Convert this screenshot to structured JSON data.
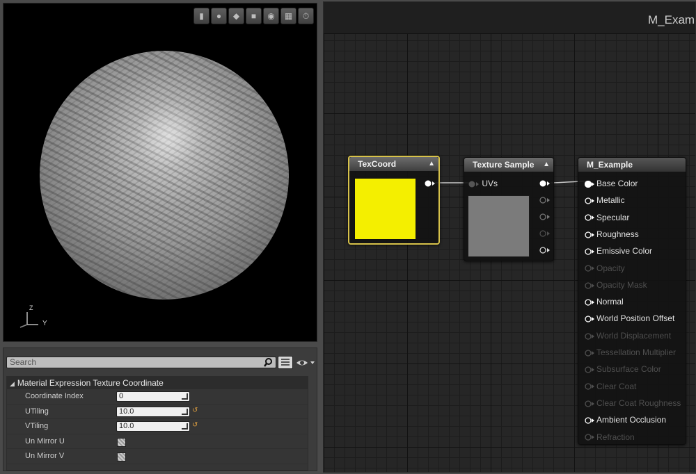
{
  "viewport": {
    "toolbar": [
      {
        "name": "cylinder-preview-icon",
        "glyph": "▮"
      },
      {
        "name": "sphere-preview-icon",
        "glyph": "●"
      },
      {
        "name": "plane-preview-icon",
        "glyph": "◆"
      },
      {
        "name": "cube-preview-icon",
        "glyph": "■"
      },
      {
        "name": "custom-mesh-icon",
        "glyph": "◉"
      },
      {
        "name": "grid-toggle-icon",
        "glyph": "▦"
      },
      {
        "name": "realtime-toggle-icon",
        "glyph": "⏱"
      }
    ],
    "axis_y": "Y",
    "axis_z": "Z"
  },
  "details": {
    "search_placeholder": "Search",
    "category_title": "Material Expression Texture Coordinate",
    "properties": [
      {
        "label": "Coordinate Index",
        "value": "0"
      },
      {
        "label": "UTiling",
        "value": "10.0"
      },
      {
        "label": "VTiling",
        "value": "10.0"
      },
      {
        "label": "Un Mirror U"
      },
      {
        "label": "Un Mirror V"
      }
    ],
    "reset_glyph": "↺"
  },
  "graph": {
    "title": "M_Example",
    "texcoord_node": {
      "title": "TexCoord",
      "swatch_color": "#f4ef00"
    },
    "texture_sample_node": {
      "title": "Texture Sample",
      "input_label": "UVs"
    },
    "result_node": {
      "title": "M_Example",
      "inputs": [
        {
          "label": "Base Color",
          "enabled": true
        },
        {
          "label": "Metallic",
          "enabled": true
        },
        {
          "label": "Specular",
          "enabled": true
        },
        {
          "label": "Roughness",
          "enabled": true
        },
        {
          "label": "Emissive Color",
          "enabled": true
        },
        {
          "label": "Opacity",
          "enabled": false
        },
        {
          "label": "Opacity Mask",
          "enabled": false
        },
        {
          "label": "Normal",
          "enabled": true
        },
        {
          "label": "World Position Offset",
          "enabled": true
        },
        {
          "label": "World Displacement",
          "enabled": false
        },
        {
          "label": "Tessellation Multiplier",
          "enabled": false
        },
        {
          "label": "Subsurface Color",
          "enabled": false
        },
        {
          "label": "Clear Coat",
          "enabled": false
        },
        {
          "label": "Clear Coat Roughness",
          "enabled": false
        },
        {
          "label": "Ambient Occlusion",
          "enabled": true
        },
        {
          "label": "Refraction",
          "enabled": false
        }
      ]
    },
    "colors": {
      "selected_outline": "#d7c24a",
      "wire": "#c8c8c8",
      "pin_enabled": "#ffffff",
      "pin_disabled": "#4f4f4f"
    }
  }
}
